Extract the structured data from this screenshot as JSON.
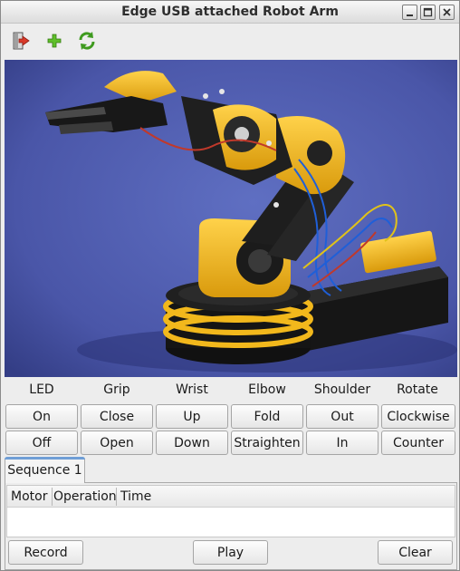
{
  "window": {
    "title": "Edge USB attached Robot Arm"
  },
  "toolbar": {
    "icons": [
      "exit-icon",
      "add-icon",
      "refresh-icon"
    ]
  },
  "controls": {
    "labels": [
      "LED",
      "Grip",
      "Wrist",
      "Elbow",
      "Shoulder",
      "Rotate"
    ],
    "row1": [
      "On",
      "Close",
      "Up",
      "Fold",
      "Out",
      "Clockwise"
    ],
    "row2": [
      "Off",
      "Open",
      "Down",
      "Straighten",
      "In",
      "Counter"
    ]
  },
  "sequence": {
    "tab_label": "Sequence 1",
    "columns": [
      "Motor",
      "Operation",
      "Time"
    ],
    "rows": []
  },
  "actions": {
    "record": "Record",
    "play": "Play",
    "clear": "Clear"
  },
  "colors": {
    "photo_background": "#4a56a8",
    "arm_yellow": "#f2b81c",
    "arm_black": "#1e1e1e",
    "tab_accent": "#6f9ed6"
  }
}
